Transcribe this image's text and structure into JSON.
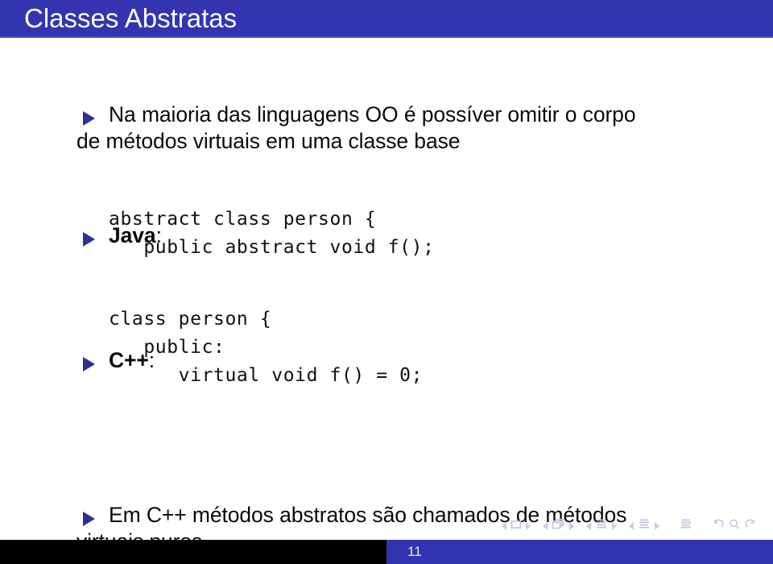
{
  "slide": {
    "title": "Classes Abstratas",
    "header_color": "#3234b0",
    "bullet_color": "#2f2f96",
    "text_color": "#0a0a0a",
    "page_number": "11"
  },
  "content": [
    {
      "kind": "bullet",
      "lines": [
        "Na maioria das linguagens OO é possíver omitir o corpo",
        "de métodos virtuais em uma classe base"
      ]
    },
    {
      "kind": "bullet-label",
      "label": "Java",
      "suffix": ":"
    },
    {
      "kind": "code",
      "lines": [
        "abstract class person {",
        "   public abstract void f();"
      ]
    },
    {
      "kind": "bullet-label",
      "label": "C++",
      "suffix": ":"
    },
    {
      "kind": "code",
      "lines": [
        "class person {",
        "   public:",
        "      virtual void f() = 0;"
      ]
    },
    {
      "kind": "bullet",
      "lines": [
        "Em C++ métodos abstratos são chamados de métodos",
        "virtuais puros"
      ]
    }
  ],
  "navigation": {
    "groups": [
      {
        "icon": "slide-icon",
        "prev": "◂",
        "next": "▸"
      },
      {
        "icon": "frames-icon",
        "prev": "◂",
        "next": "▸"
      },
      {
        "icon": "subsection-icon",
        "prev": "◂",
        "next": "▸"
      },
      {
        "icon": "section-icon",
        "prev": "◂",
        "next": "▸"
      }
    ],
    "presentation_icon": "presentation-icon",
    "back_icon": "undo-arrow-icon",
    "search_icon": "search-icon",
    "forward_icon": "redo-arrow-icon"
  }
}
